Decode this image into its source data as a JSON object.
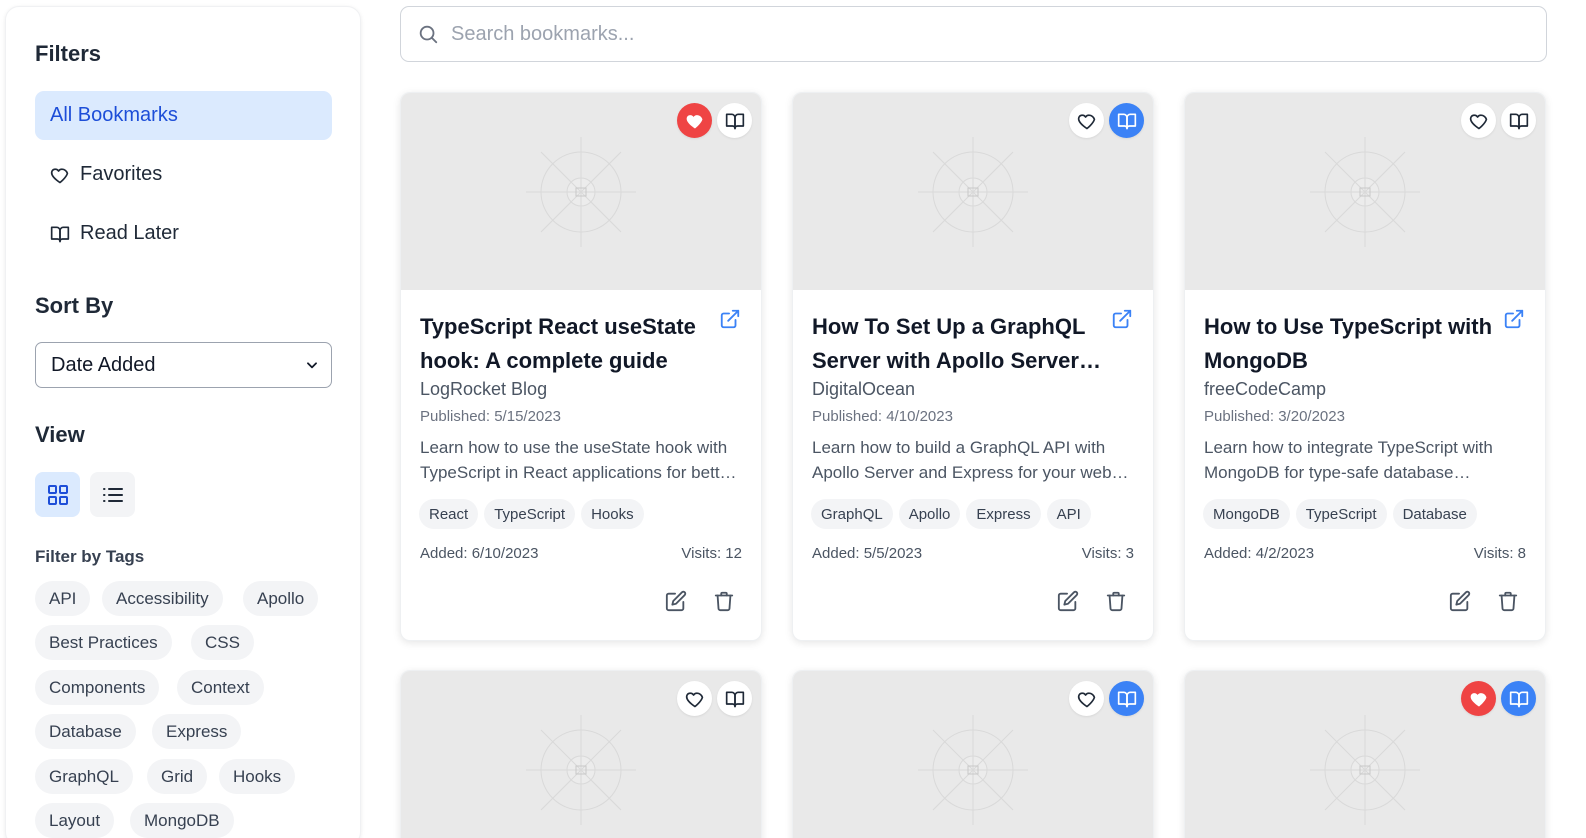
{
  "sidebar": {
    "filters_title": "Filters",
    "nav": [
      {
        "label": "All Bookmarks",
        "icon": "none",
        "active": true
      },
      {
        "label": "Favorites",
        "icon": "heart-icon",
        "active": false
      },
      {
        "label": "Read Later",
        "icon": "book-open-icon",
        "active": false
      }
    ],
    "sort_title": "Sort By",
    "sort_value": "Date Added",
    "view_title": "View",
    "view_options": [
      {
        "icon": "grid-icon",
        "active": true
      },
      {
        "icon": "list-icon",
        "active": false
      }
    ],
    "tags_title": "Filter by Tags",
    "tags": [
      "API",
      "Accessibility",
      "Apollo",
      "Best Practices",
      "CSS",
      "Components",
      "Context",
      "Database",
      "Express",
      "GraphQL",
      "Grid",
      "Hooks",
      "Layout",
      "MongoDB"
    ]
  },
  "search": {
    "placeholder": "Search bookmarks..."
  },
  "colors": {
    "accent": "#3b82f6",
    "favorite": "#ef4444",
    "active_bg": "#dbeafe",
    "active_text": "#1d4ed8"
  },
  "cards": [
    {
      "title": "TypeScript React useState hook: A complete guide",
      "source": "LogRocket Blog",
      "published": "Published: 5/15/2023",
      "description": "Learn how to use the useState hook with TypeScript in React applications for better type safety.",
      "tags": [
        "React",
        "TypeScript",
        "Hooks"
      ],
      "added": "Added: 6/10/2023",
      "visits": "Visits: 12",
      "favorite": true,
      "read_later": false
    },
    {
      "title": "How To Set Up a GraphQL Server with Apollo Server and Express",
      "source": "DigitalOcean",
      "published": "Published: 4/10/2023",
      "description": "Learn how to build a GraphQL API with Apollo Server and Express for your web applications.",
      "tags": [
        "GraphQL",
        "Apollo",
        "Express",
        "API"
      ],
      "added": "Added: 5/5/2023",
      "visits": "Visits: 3",
      "favorite": false,
      "read_later": true
    },
    {
      "title": "How to Use TypeScript with MongoDB",
      "source": "freeCodeCamp",
      "published": "Published: 3/20/2023",
      "description": "Learn how to integrate TypeScript with MongoDB for type-safe database operations.",
      "tags": [
        "MongoDB",
        "TypeScript",
        "Database"
      ],
      "added": "Added: 4/2/2023",
      "visits": "Visits: 8",
      "favorite": false,
      "read_later": false
    },
    {
      "favorite": false,
      "read_later": false
    },
    {
      "favorite": false,
      "read_later": true
    },
    {
      "favorite": true,
      "read_later": true
    }
  ]
}
